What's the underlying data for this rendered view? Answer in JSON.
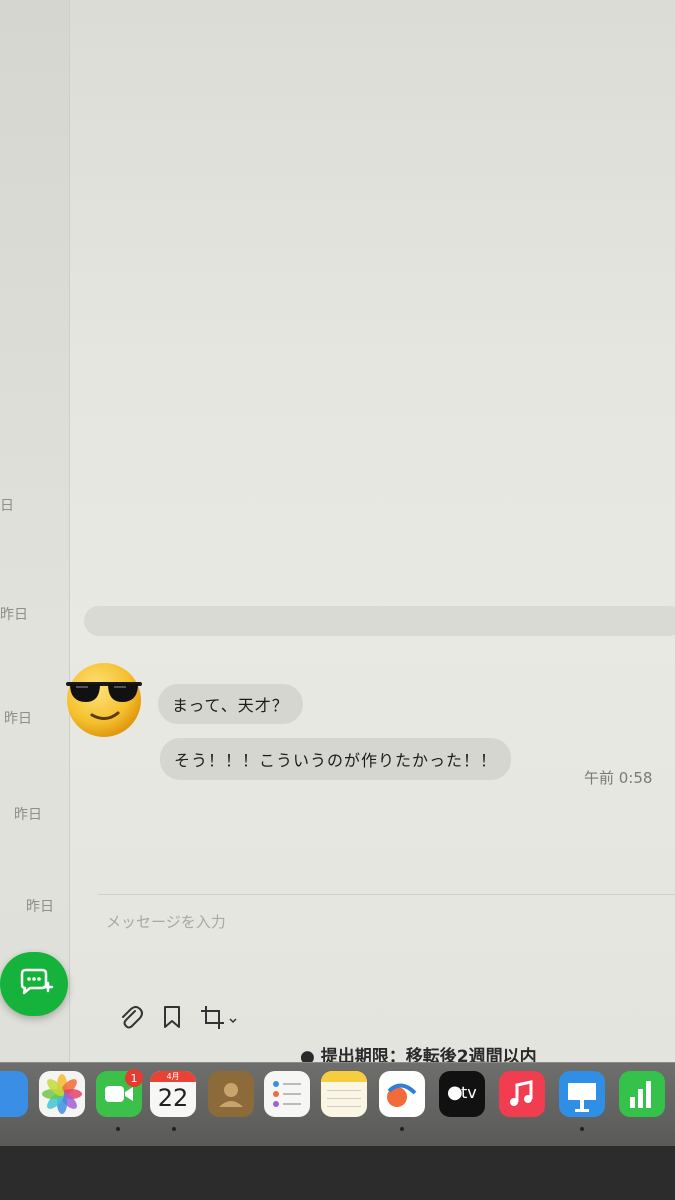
{
  "sidebar": {
    "dates": [
      "日",
      "昨日",
      "昨日",
      "昨日",
      "昨日"
    ]
  },
  "chat": {
    "messages": [
      {
        "text": "まって、天才？"
      },
      {
        "text": "そう！！！こういうのが作りたかった！！"
      }
    ],
    "timestamp": "午前 0:58"
  },
  "composer": {
    "placeholder": "メッセージを入力"
  },
  "behind_window": {
    "text": "提出期限：移転後2週間以内"
  },
  "dock": {
    "calendar": {
      "month": "4月",
      "day": "22"
    },
    "facetime_badge": "1",
    "tv_label": "tv"
  },
  "colors": {
    "fab": "#15b33c",
    "bubble": "#d6d6d1",
    "badge": "#e53b30"
  }
}
